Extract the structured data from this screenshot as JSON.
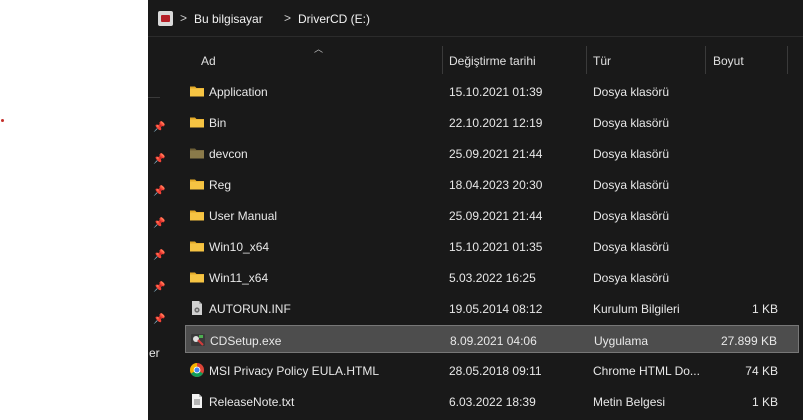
{
  "breadcrumb": {
    "separator": ">",
    "items": [
      "Bu bilgisayar",
      "DriverCD (E:)"
    ]
  },
  "columns": {
    "name": "Ad",
    "date": "Değiştirme tarihi",
    "type": "Tür",
    "size": "Boyut"
  },
  "sidebar": {
    "truncated_label": "er"
  },
  "files": [
    {
      "name": "Application",
      "date": "15.10.2021 01:39",
      "type": "Dosya klasörü",
      "size": "",
      "icon": "folder-icon"
    },
    {
      "name": "Bin",
      "date": "22.10.2021 12:19",
      "type": "Dosya klasörü",
      "size": "",
      "icon": "folder-icon"
    },
    {
      "name": "devcon",
      "date": "25.09.2021 21:44",
      "type": "Dosya klasörü",
      "size": "",
      "icon": "folder-dark-icon"
    },
    {
      "name": "Reg",
      "date": "18.04.2023 20:30",
      "type": "Dosya klasörü",
      "size": "",
      "icon": "folder-icon"
    },
    {
      "name": "User Manual",
      "date": "25.09.2021 21:44",
      "type": "Dosya klasörü",
      "size": "",
      "icon": "folder-icon"
    },
    {
      "name": "Win10_x64",
      "date": "15.10.2021 01:35",
      "type": "Dosya klasörü",
      "size": "",
      "icon": "folder-icon"
    },
    {
      "name": "Win11_x64",
      "date": "5.03.2022 16:25",
      "type": "Dosya klasörü",
      "size": "",
      "icon": "folder-icon"
    },
    {
      "name": "AUTORUN.INF",
      "date": "19.05.2014 08:12",
      "type": "Kurulum Bilgileri",
      "size": "1 KB",
      "icon": "inf-file-icon"
    },
    {
      "name": "CDSetup.exe",
      "date": "8.09.2021 04:06",
      "type": "Uygulama",
      "size": "27.899 KB",
      "icon": "exe-icon"
    },
    {
      "name": "MSI Privacy Policy EULA.HTML",
      "date": "28.05.2018 09:11",
      "type": "Chrome HTML Do...",
      "size": "74 KB",
      "icon": "chrome-icon"
    },
    {
      "name": "ReleaseNote.txt",
      "date": "6.03.2022 18:39",
      "type": "Metin Belgesi",
      "size": "1 KB",
      "icon": "text-file-icon"
    }
  ],
  "selected_index": 8,
  "colors": {
    "background": "#191919",
    "folder": "#f6c443",
    "selection": "#4d4d4d",
    "text": "#e8e8e8"
  }
}
